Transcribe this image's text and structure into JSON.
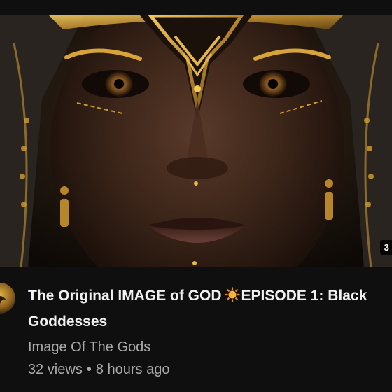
{
  "video": {
    "title_part1": "The Original IMAGE of GOD",
    "title_emoji": "sun-emoji",
    "title_part2": "EPISODE 1: Black Goddesses",
    "duration_badge": "3",
    "channel_name": "Image Of The Gods",
    "views": "32 views",
    "separator": "•",
    "published": "8 hours ago"
  },
  "colors": {
    "background": "#0f0f0f",
    "title": "#f1f1f1",
    "secondary_text": "#aaaaaa",
    "gold_accent": "#c9982e"
  },
  "icons": {
    "title_emoji": "sun-emoji",
    "avatar": "channel-avatar-gold-emblem"
  }
}
